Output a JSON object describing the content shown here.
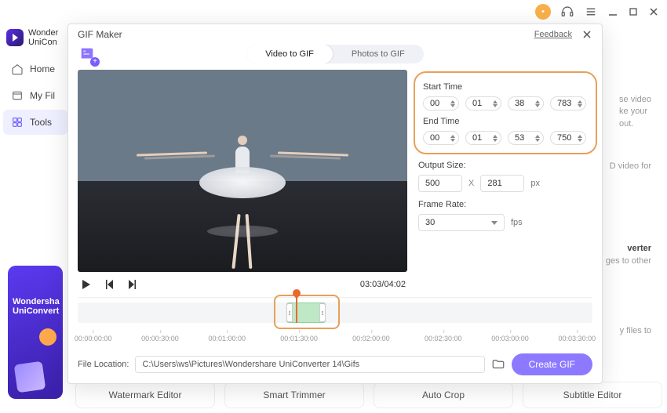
{
  "app": {
    "brand_line1": "Wonder",
    "brand_line2": "UniCon",
    "nav": {
      "home": "Home",
      "files": "My Fil",
      "tools": "Tools"
    },
    "promo_line1": "Wondersha",
    "promo_line2": "UniConvert",
    "bottom_tools": [
      "Watermark Editor",
      "Smart Trimmer",
      "Auto Crop",
      "Subtitle Editor"
    ],
    "side_snippets": {
      "t1a": "se video",
      "t1b": "ke your",
      "t1c": "out.",
      "t2": "D video for",
      "t3": "verter",
      "t4": "ges to other",
      "t5": "y files to"
    }
  },
  "modal": {
    "title": "GIF Maker",
    "feedback": "Feedback",
    "tabs": {
      "video": "Video to GIF",
      "photos": "Photos to GIF"
    },
    "time_counter": "03:03/04:02",
    "start_label": "Start Time",
    "end_label": "End Time",
    "start": {
      "hh": "00",
      "mm": "01",
      "ss": "38",
      "ms": "783"
    },
    "end": {
      "hh": "00",
      "mm": "01",
      "ss": "53",
      "ms": "750"
    },
    "output_label": "Output Size:",
    "output_w": "500",
    "output_h": "281",
    "output_x": "X",
    "output_unit": "px",
    "framerate_label": "Frame Rate:",
    "framerate_value": "30",
    "framerate_unit": "fps",
    "ticks": [
      "00:00:00:00",
      "00:00:30:00",
      "00:01:00:00",
      "00:01:30:00",
      "00:02:00:00",
      "00:02:30:00",
      "00:03:00:00",
      "00:03:30:00"
    ],
    "file_location_label": "File Location:",
    "file_location_value": "C:\\Users\\ws\\Pictures\\Wondershare UniConverter 14\\Gifs",
    "create_button": "Create GIF"
  }
}
